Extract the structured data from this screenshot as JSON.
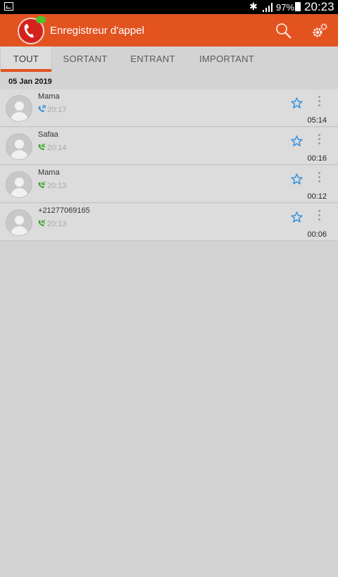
{
  "status_bar": {
    "battery": "97%",
    "time": "20:23"
  },
  "app_bar": {
    "title": "Enregistreur d'appel"
  },
  "tabs": [
    {
      "label": "TOUT",
      "active": true
    },
    {
      "label": "SORTANT",
      "active": false
    },
    {
      "label": "ENTRANT",
      "active": false
    },
    {
      "label": "IMPORTANT",
      "active": false
    }
  ],
  "date_header": "05 Jan 2019",
  "calls": [
    {
      "name": "Mama",
      "time": "20:17",
      "duration": "05:14",
      "direction": "outgoing",
      "icon_color": "#2f8fe0"
    },
    {
      "name": "Safaa",
      "time": "20:14",
      "duration": "00:16",
      "direction": "incoming",
      "icon_color": "#3aa42a"
    },
    {
      "name": "Mama",
      "time": "20:13",
      "duration": "00:12",
      "direction": "incoming",
      "icon_color": "#3aa42a"
    },
    {
      "name": "+21277069165",
      "time": "20:13",
      "duration": "00:06",
      "direction": "incoming",
      "icon_color": "#3aa42a"
    }
  ],
  "colors": {
    "accent": "#e25320",
    "star": "#2f8fe0"
  }
}
